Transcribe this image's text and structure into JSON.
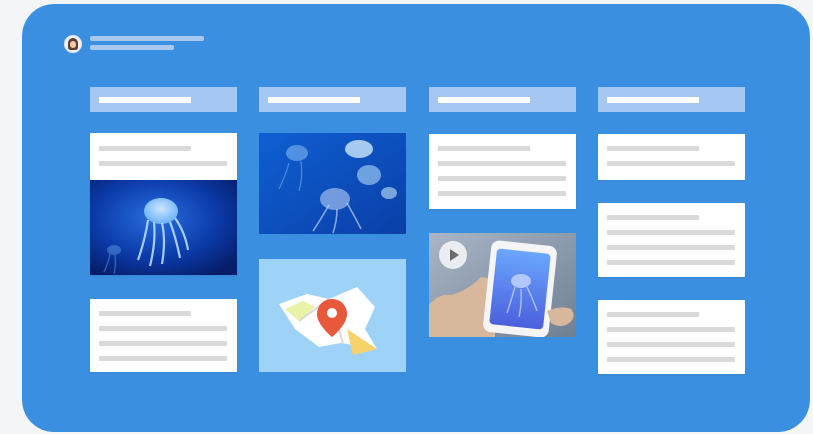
{
  "board": {
    "background_color": "#3b8fe0"
  },
  "header": {
    "avatar_icon": "user-avatar-icon"
  },
  "columns": [
    {
      "name": "column-1"
    },
    {
      "name": "column-2"
    },
    {
      "name": "column-3"
    },
    {
      "name": "column-4"
    }
  ],
  "media": {
    "jellyfish_photo": "jellyfish-photo",
    "jellyfish_group_photo": "jellyfish-group-photo",
    "map_icon": "map-pin-icon",
    "video_icon": "play-video-icon"
  },
  "colors": {
    "card": "#ffffff",
    "column_header": "#a5c7f1",
    "placeholder_line": "#d9d9d9",
    "map_pin": "#e8583a"
  }
}
